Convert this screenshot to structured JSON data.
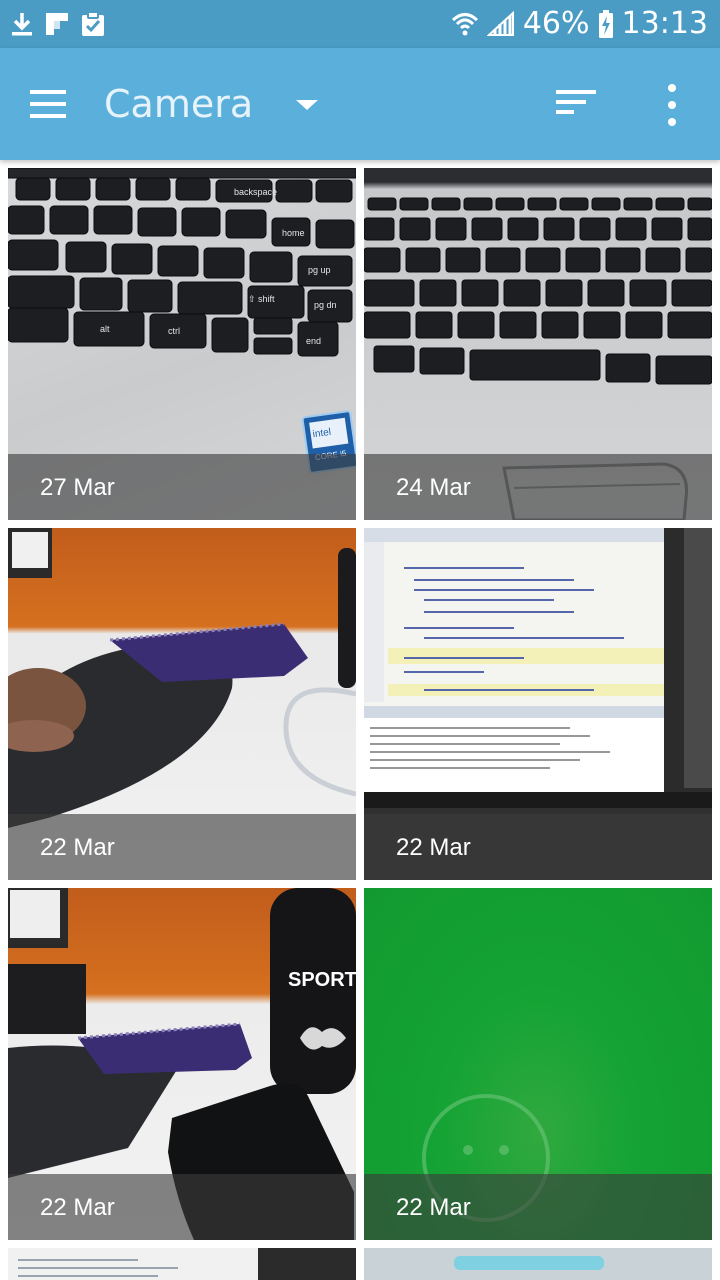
{
  "status_bar": {
    "battery": "46%",
    "time": "13:13",
    "left_icons": [
      "download-icon",
      "flipboard-icon",
      "clipboard-check-icon"
    ],
    "right_icons": [
      "wifi-icon",
      "signal-icon",
      "battery-charging-icon"
    ]
  },
  "app_bar": {
    "title": "Camera",
    "icons": [
      "menu-icon",
      "dropdown-caret-icon",
      "sort-icon",
      "more-vert-icon"
    ]
  },
  "gallery": {
    "tiles": [
      {
        "date": "27 Mar",
        "subject": "keyboard"
      },
      {
        "date": "24 Mar",
        "subject": "keyboard-touchpad"
      },
      {
        "date": "22 Mar",
        "subject": "desk-notebook-mousepad"
      },
      {
        "date": "22 Mar",
        "subject": "laptop-screen-code"
      },
      {
        "date": "22 Mar",
        "subject": "desk-bottle-phone"
      },
      {
        "date": "22 Mar",
        "subject": "green-screen"
      }
    ]
  },
  "photo_text": {
    "bottle_label": "SPORT",
    "sticker_brand": "intel",
    "sticker_line": "CORE i5",
    "keys": {
      "alt": "alt",
      "ctrl": "ctrl",
      "shift": "⇧ shift",
      "pgup": "pg up",
      "pgdn": "pg dn",
      "end": "end",
      "home": "home",
      "backspace": "backspace"
    }
  },
  "colors": {
    "status_bar": "#4a9cc4",
    "app_bar": "#5ab0da",
    "caption_overlay": "rgba(60,60,60,0.62)"
  }
}
